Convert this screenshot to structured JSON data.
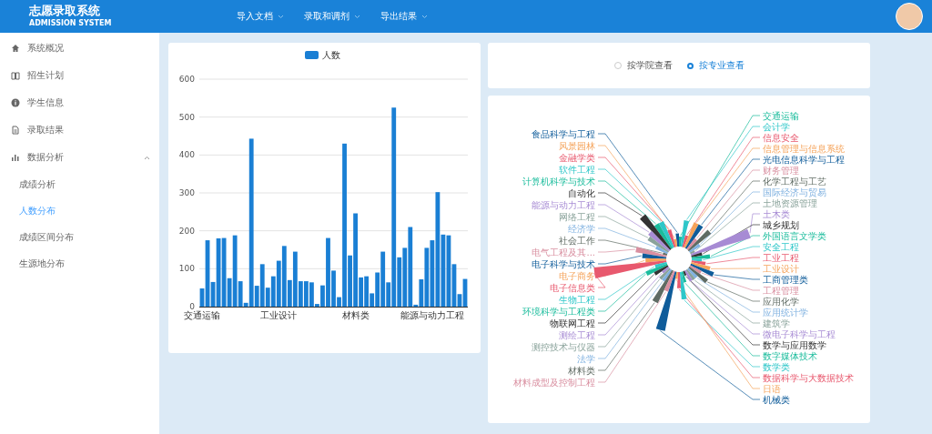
{
  "header": {
    "title": "志愿录取系统",
    "subtitle": "ADMISSION SYSTEM",
    "nav": [
      {
        "label": "导入文档"
      },
      {
        "label": "录取和调剂"
      },
      {
        "label": "导出结果"
      }
    ]
  },
  "sidebar": {
    "items": [
      {
        "label": "系统概况"
      },
      {
        "label": "招生计划"
      },
      {
        "label": "学生信息"
      },
      {
        "label": "录取结果"
      },
      {
        "label": "数据分析",
        "expanded": true,
        "children": [
          {
            "label": "成绩分析",
            "selected": false
          },
          {
            "label": "人数分布",
            "selected": true
          },
          {
            "label": "成绩区间分布",
            "selected": false
          },
          {
            "label": "生源地分布",
            "selected": false
          }
        ]
      }
    ]
  },
  "bar_chart": {
    "chart_data": {
      "type": "bar",
      "grid": true,
      "categories": [
        "交通运输",
        null,
        null,
        null,
        null,
        null,
        null,
        null,
        null,
        null,
        null,
        null,
        null,
        null,
        "工业设计",
        null,
        null,
        null,
        null,
        null,
        null,
        null,
        null,
        null,
        null,
        null,
        null,
        null,
        "材料类",
        null,
        null,
        null,
        null,
        null,
        null,
        null,
        null,
        null,
        null,
        null,
        null,
        null,
        "能源与动力工程",
        null,
        null,
        null,
        null,
        null,
        null
      ],
      "series": [
        {
          "name": "人数",
          "color": "#1a7fd4",
          "values": [
            48,
            175,
            65,
            180,
            181,
            75,
            188,
            67,
            10,
            443,
            55,
            112,
            50,
            80,
            121,
            160,
            70,
            145,
            67,
            67,
            64,
            7,
            56,
            181,
            95,
            25,
            430,
            135,
            246,
            77,
            80,
            35,
            90,
            145,
            64,
            525,
            130,
            155,
            210,
            5,
            72,
            155,
            175,
            302,
            190,
            188,
            112,
            33,
            73
          ]
        }
      ],
      "ylim": [
        0,
        600
      ],
      "yticks": [
        0,
        100,
        200,
        300,
        400,
        500,
        600
      ]
    }
  },
  "view_options": [
    {
      "label": "按学院查看",
      "selected": false
    },
    {
      "label": "按专业查看",
      "selected": true
    }
  ],
  "rose_chart": {
    "right_labels": [
      "交通运输",
      "会计学",
      "信息安全",
      "信息管理与信息系统",
      "光电信息科学与工程",
      "财务管理",
      "化学工程与工艺",
      "国际经济与贸易",
      "土地资源管理",
      "土木类",
      "城乡规划",
      "外国语言文学类",
      "安全工程",
      "工业工程",
      "工业设计",
      "工商管理类",
      "工程管理",
      "应用化学",
      "应用统计学",
      "建筑学",
      "微电子科学与工程",
      "数学与应用数学",
      "数字媒体技术",
      "数学类",
      "数据科学与大数据技术",
      "日语",
      "机械类"
    ],
    "left_labels": [
      "食品科学与工程",
      "风景园林",
      "金融学类",
      "软件工程",
      "计算机科学与技术",
      "自动化",
      "能源与动力工程",
      "网络工程",
      "经济学",
      "社会工作",
      "电气工程及其...",
      "电子科学与技术",
      "电子商务",
      "电子信息类",
      "生物工程",
      "环境科学与工程类",
      "物联网工程",
      "测绘工程",
      "测控技术与仪器",
      "法学",
      "材料类",
      "材料成型及控制工程"
    ]
  }
}
